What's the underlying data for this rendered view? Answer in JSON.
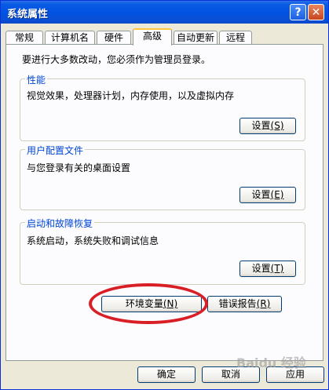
{
  "window": {
    "title": "系统属性",
    "help_label": "?",
    "close_label": "✕"
  },
  "tabs": [
    {
      "label": "常规"
    },
    {
      "label": "计算机名"
    },
    {
      "label": "硬件"
    },
    {
      "label": "高级",
      "active": true
    },
    {
      "label": "自动更新"
    },
    {
      "label": "远程"
    }
  ],
  "intro": "要进行大多数改动，您必须作为管理员登录。",
  "groups": {
    "performance": {
      "title": "性能",
      "description": "视觉效果，处理器计划，内存使用，以及虚拟内存",
      "button_text": "设置",
      "button_key": "(S)"
    },
    "user_profiles": {
      "title": "用户配置文件",
      "description": "与您登录有关的桌面设置",
      "button_text": "设置",
      "button_key": "(E)"
    },
    "startup_recovery": {
      "title": "启动和故障恢复",
      "description": "系统启动，系统失败和调试信息",
      "button_text": "设置",
      "button_key": "(T)"
    }
  },
  "env_button": {
    "text": "环境变量",
    "key": "(N)"
  },
  "error_button": {
    "text": "错误报告",
    "key": "(R)"
  },
  "footer": {
    "ok": "确定",
    "cancel": "取消",
    "apply": "应用"
  },
  "watermark": "Baidu 经验"
}
